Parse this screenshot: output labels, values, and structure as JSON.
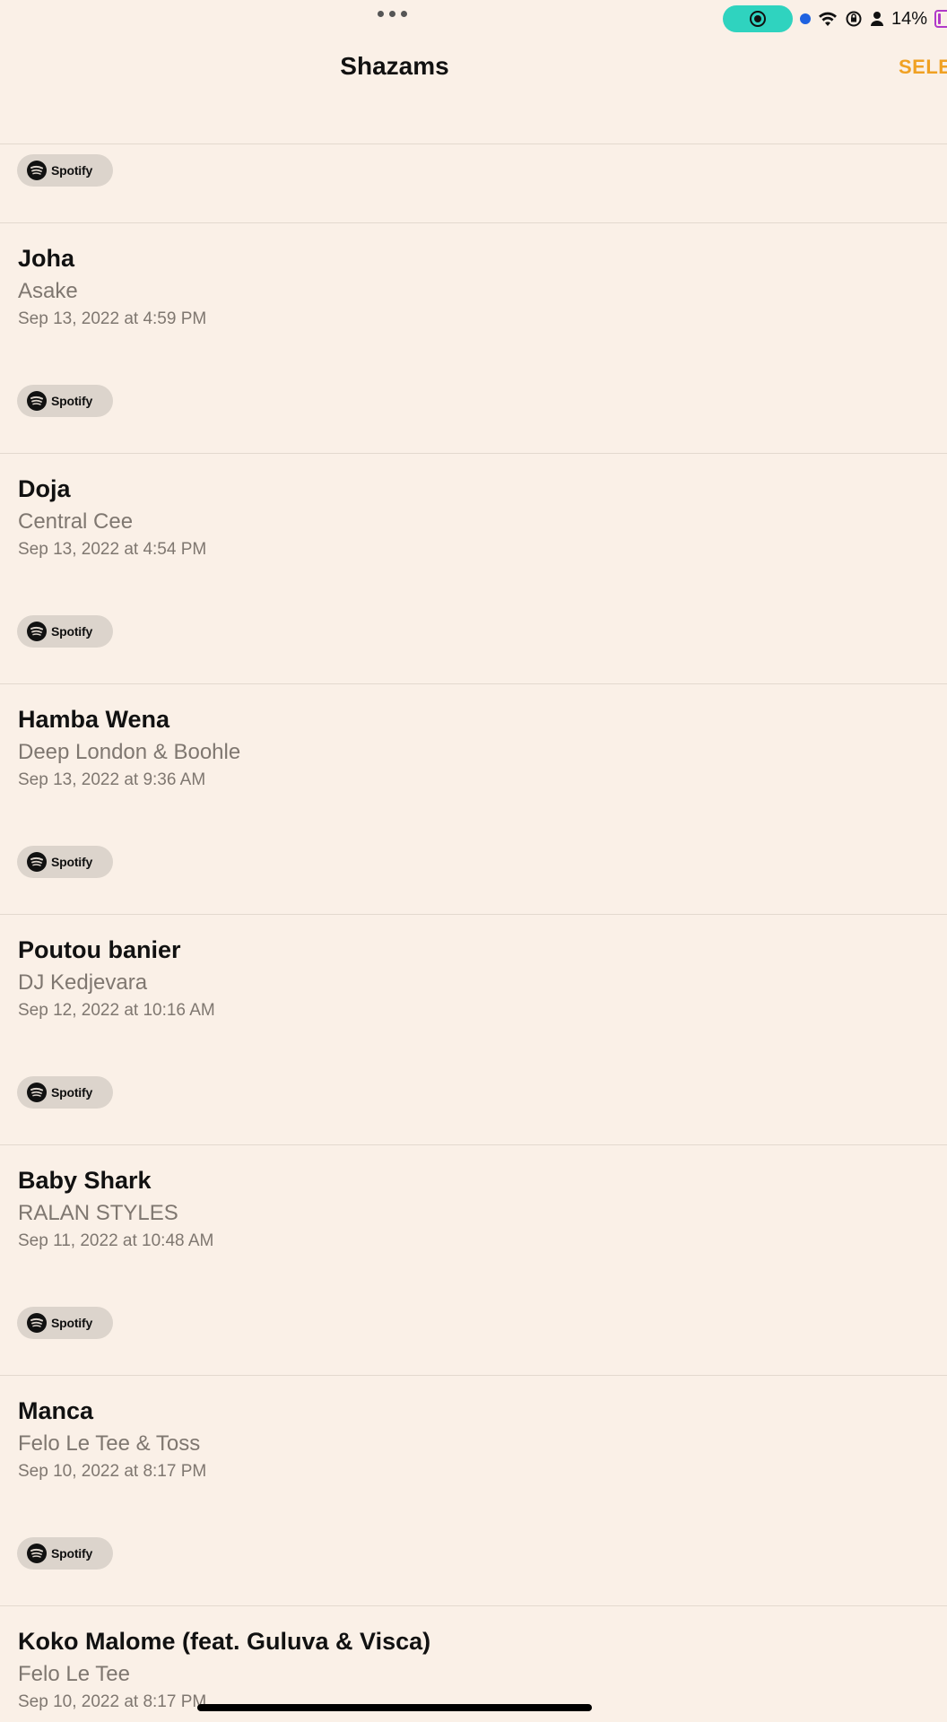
{
  "status_bar": {
    "battery_percent": "14%",
    "icons": [
      "screen-record-icon",
      "location-dot-icon",
      "wifi-icon",
      "orientation-lock-icon",
      "person-icon",
      "battery-icon"
    ]
  },
  "nav": {
    "title": "Shazams",
    "select_label": "SELE"
  },
  "service_label": "Spotify",
  "tracks": [
    {
      "title": "Joha",
      "artist": "Asake",
      "date": "Sep 13, 2022 at 4:59 PM"
    },
    {
      "title": "Doja",
      "artist": "Central Cee",
      "date": "Sep 13, 2022 at 4:54 PM"
    },
    {
      "title": "Hamba Wena",
      "artist": "Deep London & Boohle",
      "date": "Sep 13, 2022 at 9:36 AM"
    },
    {
      "title": "Poutou banier",
      "artist": "DJ Kedjevara",
      "date": "Sep 12, 2022 at 10:16 AM"
    },
    {
      "title": "Baby Shark",
      "artist": "RALAN STYLES",
      "date": "Sep 11, 2022 at 10:48 AM"
    },
    {
      "title": "Manca",
      "artist": "Felo Le Tee & Toss",
      "date": "Sep 10, 2022 at 8:17 PM"
    },
    {
      "title": "Koko Malome (feat. Guluva & Visca)",
      "artist": "Felo Le Tee",
      "date": "Sep 10, 2022 at 8:17 PM"
    }
  ],
  "colors": {
    "background": "#faf0e7",
    "accent": "#f0a123",
    "secondary_text": "#7f7770",
    "chip": "#dcd4cc"
  }
}
